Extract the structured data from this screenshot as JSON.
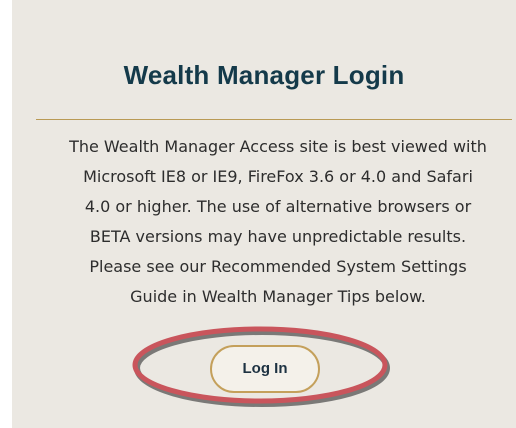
{
  "login_panel": {
    "title": "Wealth Manager Login",
    "description_lines": [
      "The Wealth Manager Access site is best viewed with",
      "Microsoft IE8 or IE9, FireFox 3.6 or 4.0 and Safari",
      "4.0 or higher. The use of alternative browsers or",
      "BETA versions may have unpredictable results.",
      "Please see our Recommended System Settings",
      "Guide in Wealth Manager Tips below."
    ],
    "login_button_label": "Log In"
  },
  "colors": {
    "panel_background": "#ebe8e2",
    "title": "#143a4a",
    "divider_gold": "#b99a55",
    "button_border_gold": "#c4a05b",
    "highlight_red": "#c9555c",
    "highlight_shadow": "#4a4a4a"
  }
}
